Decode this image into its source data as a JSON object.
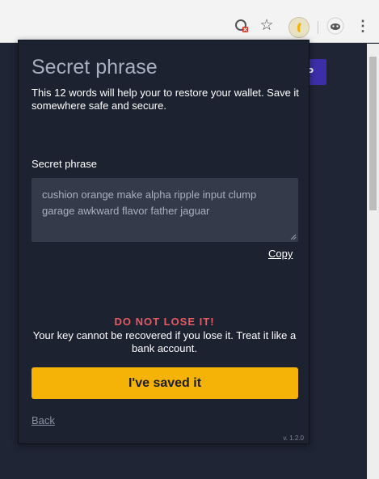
{
  "browser": {
    "icons": {
      "lens": "lens-blocked-icon",
      "star": "bookmark-star-icon",
      "extension": "extension-icon",
      "profile": "profile-icon",
      "menu": "menu-icon"
    }
  },
  "background_page": {
    "button_label": "P"
  },
  "popup": {
    "title": "Secret phrase",
    "description": "This 12 words will help your to restore your wallet. Save it somewhere safe and secure.",
    "phrase_label": "Secret phrase",
    "phrase": "cushion orange make alpha ripple input clump garage awkward flavor father jaguar",
    "copy_label": "Copy",
    "warning_title": "DO NOT LOSE IT!",
    "warning_text": "Your key cannot be recovered if you lose it. Treat it like a bank account.",
    "cta_label": "I've saved it",
    "back_label": "Back",
    "version": "v. 1.2.0"
  },
  "colors": {
    "accent": "#f6b307",
    "warning": "#e55b63",
    "panel": "#1d2230",
    "field": "#343a4a"
  }
}
